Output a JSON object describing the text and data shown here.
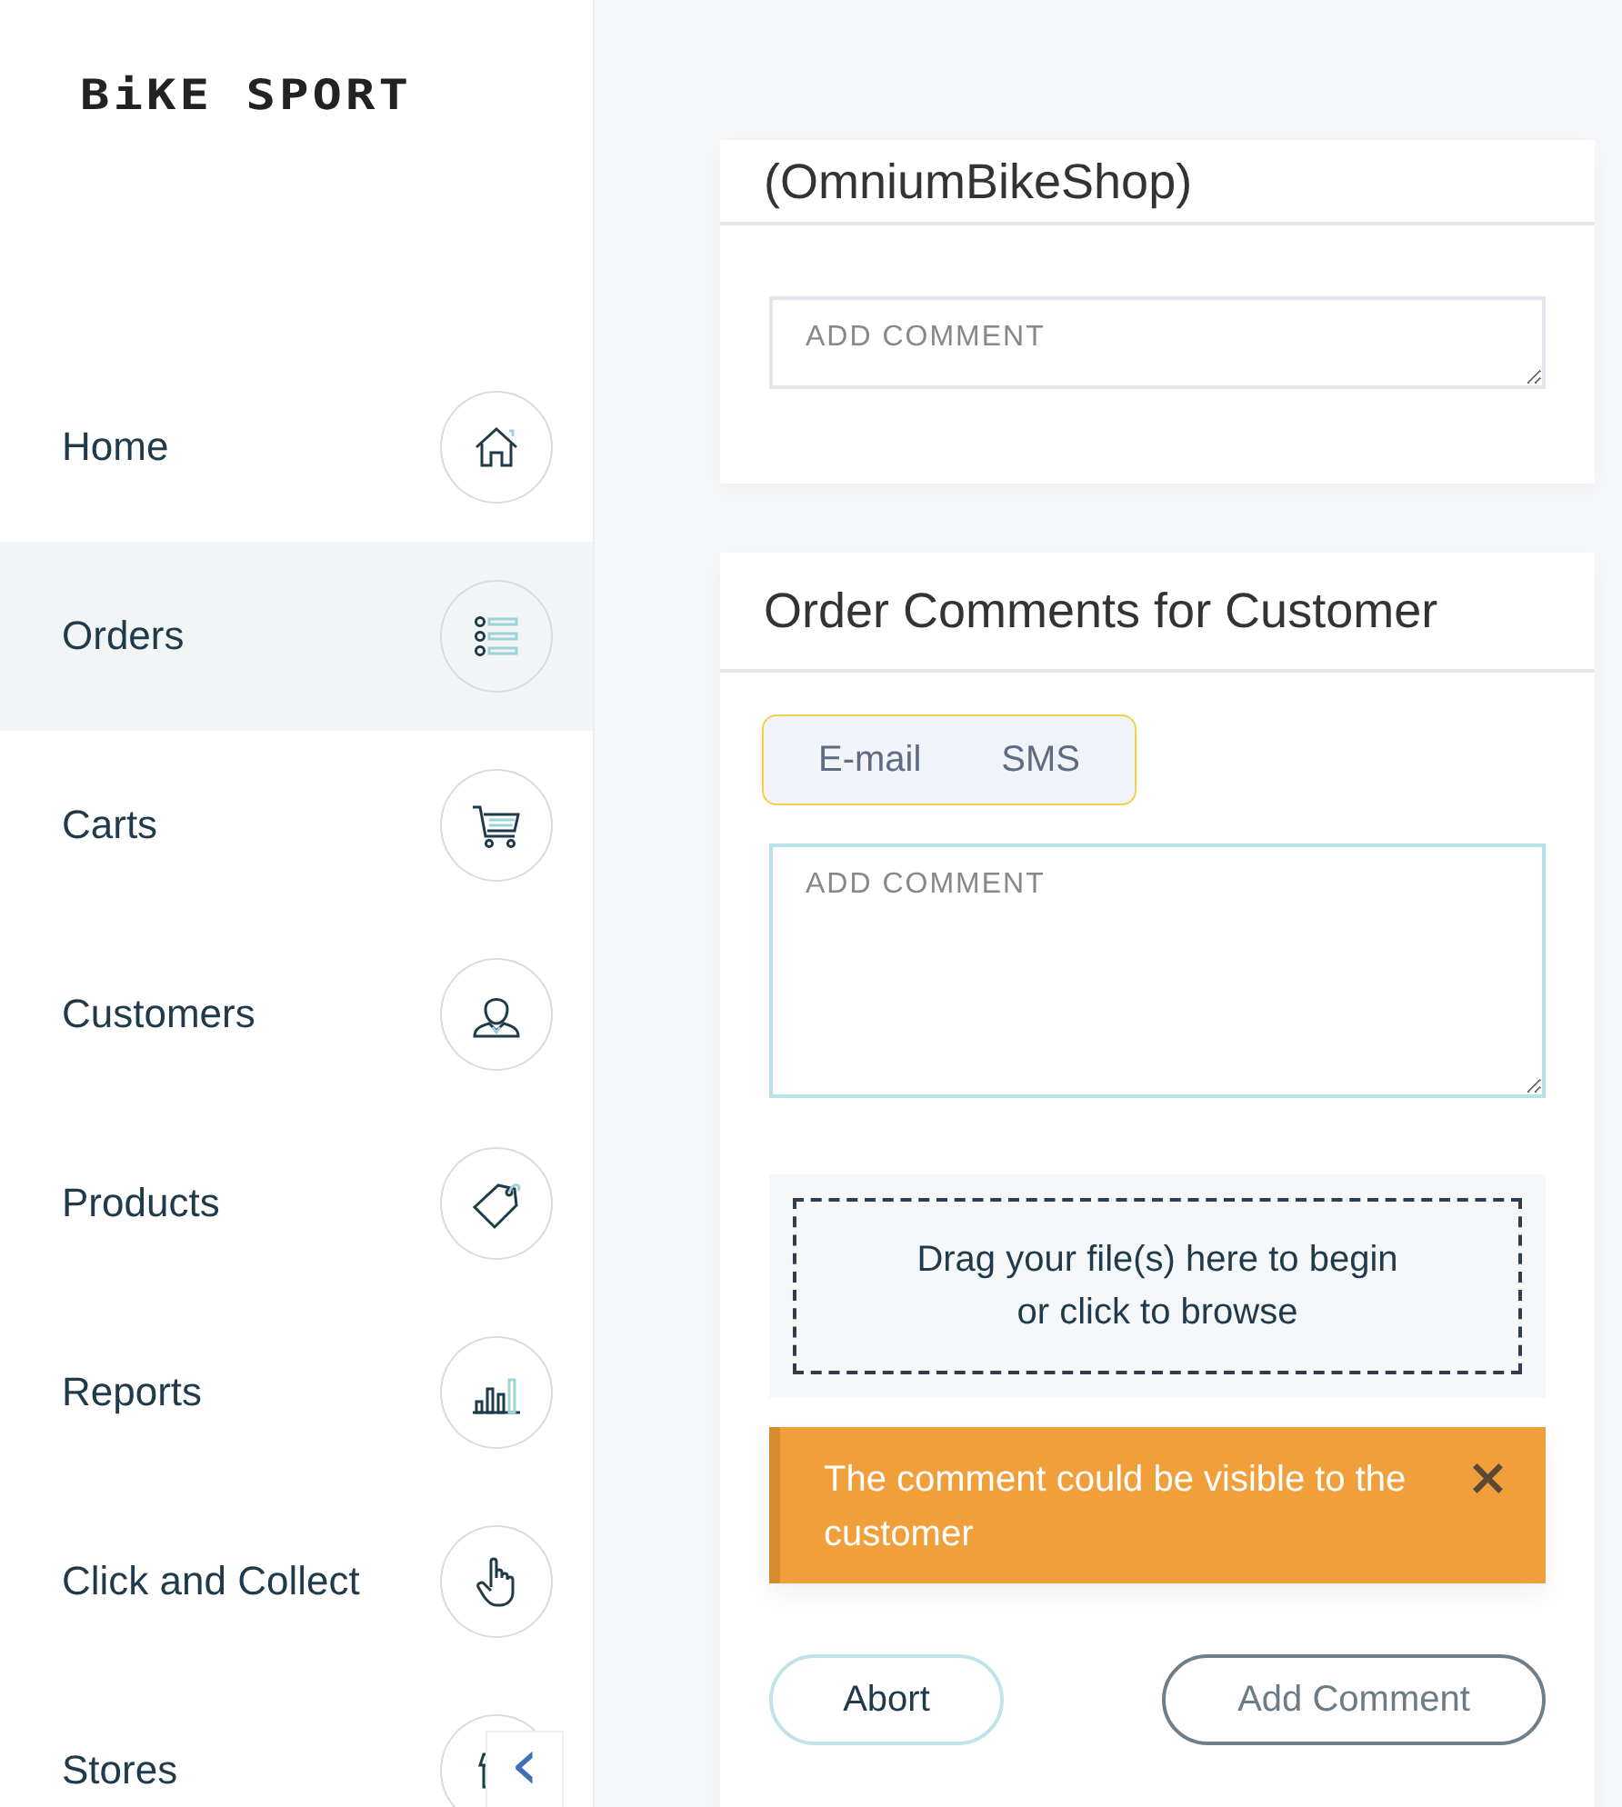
{
  "sidebar": {
    "logo": "BiKE SPORT",
    "items": [
      {
        "label": "Home",
        "kind": "home",
        "selected": false
      },
      {
        "label": "Orders",
        "kind": "list",
        "selected": true
      },
      {
        "label": "Carts",
        "kind": "cart",
        "selected": false
      },
      {
        "label": "Customers",
        "kind": "person",
        "selected": false
      },
      {
        "label": "Products",
        "kind": "tag",
        "selected": false
      },
      {
        "label": "Reports",
        "kind": "chart",
        "selected": false
      },
      {
        "label": "Click and Collect",
        "kind": "hand",
        "selected": false
      },
      {
        "label": "Stores",
        "kind": "store",
        "selected": false
      }
    ],
    "collapse_button": "‹"
  },
  "internal_comments": {
    "title": "(OmniumBikeShop)",
    "field": {
      "placeholder": "ADD COMMENT",
      "focused": false
    }
  },
  "customer_comments": {
    "title": "Order Comments for Customer",
    "channels": [
      {
        "label": "E-mail",
        "selected": false
      },
      {
        "label": "SMS",
        "selected": false
      }
    ],
    "field": {
      "placeholder": "ADD COMMENT",
      "focused": true
    },
    "dropzone": [
      "Drag your file(s) here to begin",
      "or click to browse"
    ],
    "alert": {
      "text": "The comment could be visible to the customer",
      "close": "×"
    },
    "buttons": [
      {
        "label": "Abort",
        "kind": "secondary"
      },
      {
        "label": "Add Comment",
        "kind": "primary"
      }
    ]
  }
}
